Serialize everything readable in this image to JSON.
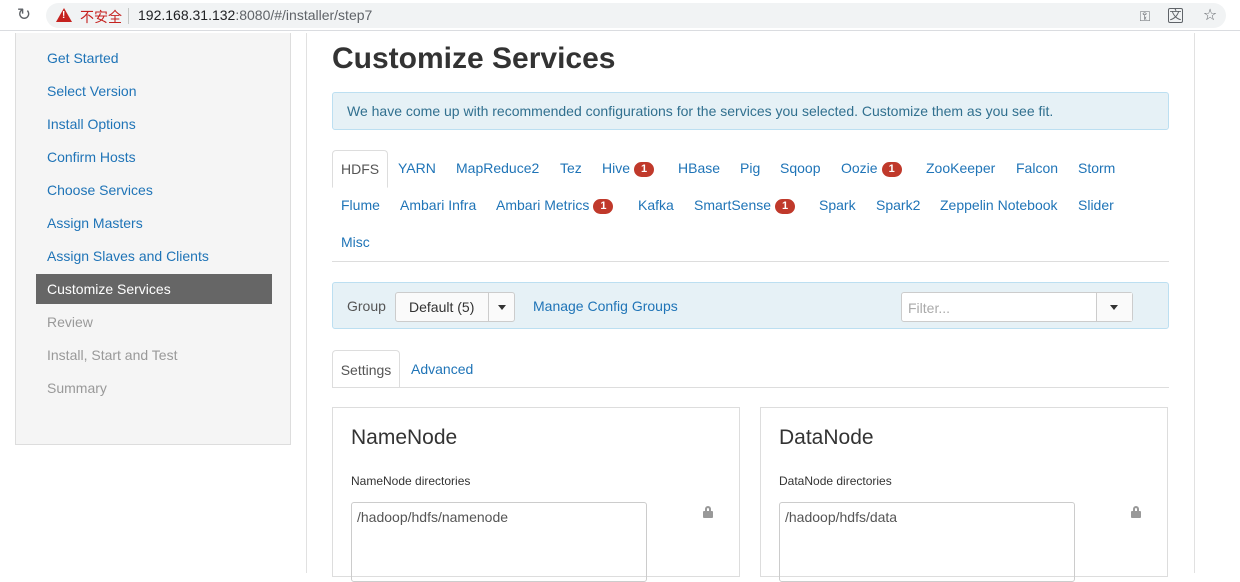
{
  "browser": {
    "reload_icon": "reload-icon",
    "security_label": "不安全",
    "url_host": "192.168.31.132",
    "url_rest": ":8080/#/installer/step7"
  },
  "sidebar": {
    "items": [
      {
        "label": "Get Started",
        "state": "link"
      },
      {
        "label": "Select Version",
        "state": "link"
      },
      {
        "label": "Install Options",
        "state": "link"
      },
      {
        "label": "Confirm Hosts",
        "state": "link"
      },
      {
        "label": "Choose Services",
        "state": "link"
      },
      {
        "label": "Assign Masters",
        "state": "link"
      },
      {
        "label": "Assign Slaves and Clients",
        "state": "link"
      },
      {
        "label": "Customize Services",
        "state": "active"
      },
      {
        "label": "Review",
        "state": "disabled"
      },
      {
        "label": "Install, Start and Test",
        "state": "disabled"
      },
      {
        "label": "Summary",
        "state": "disabled"
      }
    ]
  },
  "main": {
    "title": "Customize Services",
    "info": "We have come up with recommended configurations for the services you selected. Customize them as you see fit."
  },
  "service_tabs": {
    "row1": [
      {
        "label": "HDFS",
        "active": true
      },
      {
        "label": "YARN"
      },
      {
        "label": "MapReduce2"
      },
      {
        "label": "Tez"
      },
      {
        "label": "Hive",
        "badge": "1"
      },
      {
        "label": "HBase"
      },
      {
        "label": "Pig"
      },
      {
        "label": "Sqoop"
      },
      {
        "label": "Oozie",
        "badge": "1"
      },
      {
        "label": "ZooKeeper"
      },
      {
        "label": "Falcon"
      },
      {
        "label": "Storm"
      }
    ],
    "row2": [
      {
        "label": "Flume"
      },
      {
        "label": "Ambari Infra"
      },
      {
        "label": "Ambari Metrics",
        "badge": "1"
      },
      {
        "label": "Kafka"
      },
      {
        "label": "SmartSense",
        "badge": "1"
      },
      {
        "label": "Spark"
      },
      {
        "label": "Spark2"
      },
      {
        "label": "Zeppelin Notebook"
      },
      {
        "label": "Slider"
      }
    ],
    "row3": [
      {
        "label": "Misc"
      }
    ]
  },
  "group_bar": {
    "label": "Group",
    "selected": "Default (5)",
    "manage_link": "Manage Config Groups",
    "filter_placeholder": "Filter..."
  },
  "sub_tabs": {
    "settings": "Settings",
    "advanced": "Advanced"
  },
  "panels": {
    "namenode": {
      "title": "NameNode",
      "field_label": "NameNode directories",
      "value": "/hadoop/hdfs/namenode"
    },
    "datanode": {
      "title": "DataNode",
      "field_label": "DataNode directories",
      "value": "/hadoop/hdfs/data"
    }
  },
  "colors": {
    "link": "#1f74b7",
    "active_sidebar": "#666666",
    "badge": "#c0392b",
    "info_bg": "#e6f1f6"
  }
}
